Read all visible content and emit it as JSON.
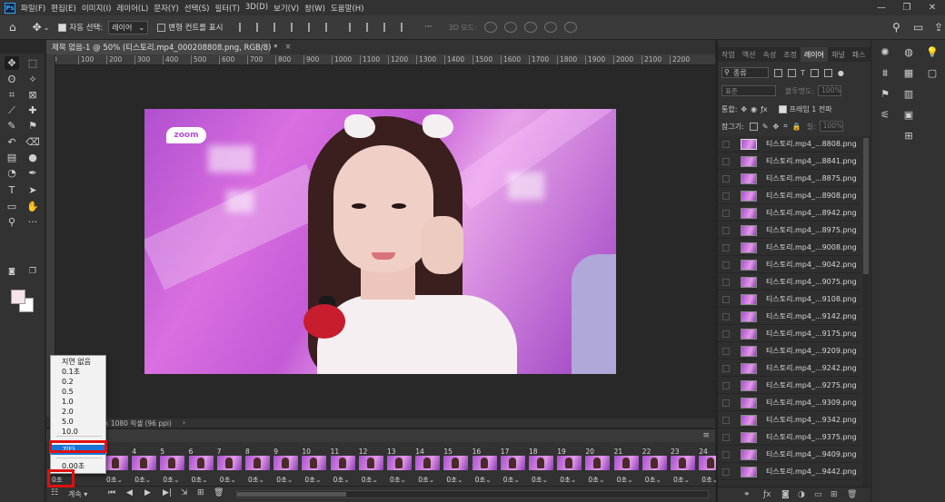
{
  "menu": {
    "logo": "Ps",
    "items": [
      "파일(F)",
      "편집(E)",
      "이미지(I)",
      "레이어(L)",
      "문자(Y)",
      "선택(S)",
      "필터(T)",
      "3D(D)",
      "보기(V)",
      "창(W)",
      "도움말(H)"
    ],
    "window_controls": [
      "—",
      "❐",
      "✕"
    ]
  },
  "options": {
    "auto_select_label": "자동 선택:",
    "auto_select_value": "레이어",
    "transform_label": "변형 컨트롤 표시",
    "mode_3d_label": "3D 모드:"
  },
  "document": {
    "tab_title": "제목 없음-1 @ 50% (티스토리.mp4_000208808.png, RGB/8) *",
    "tab_close": "×",
    "ruler_ticks": [
      "0",
      "100",
      "200",
      "300",
      "400",
      "500",
      "600",
      "700",
      "800",
      "900",
      "1000",
      "1100",
      "1200",
      "1300",
      "1400",
      "1500",
      "1600",
      "1700",
      "1800",
      "1900",
      "2000",
      "2100",
      "2200"
    ],
    "watermark_text": "zoom",
    "status_text": "x 1080 픽셀 (96 ppi)",
    "status_arrow": "›"
  },
  "timeline": {
    "frames": [
      {
        "num": "3",
        "delay": "0초"
      },
      {
        "num": "4",
        "delay": "0초"
      },
      {
        "num": "5",
        "delay": "0초"
      },
      {
        "num": "6",
        "delay": "0초"
      },
      {
        "num": "7",
        "delay": "0초"
      },
      {
        "num": "8",
        "delay": "0초"
      },
      {
        "num": "9",
        "delay": "0초"
      },
      {
        "num": "10",
        "delay": "0초"
      },
      {
        "num": "11",
        "delay": "0초"
      },
      {
        "num": "12",
        "delay": "0초"
      },
      {
        "num": "13",
        "delay": "0초"
      },
      {
        "num": "14",
        "delay": "0초"
      },
      {
        "num": "15",
        "delay": "0초"
      },
      {
        "num": "16",
        "delay": "0초"
      },
      {
        "num": "17",
        "delay": "0초"
      },
      {
        "num": "18",
        "delay": "0초"
      },
      {
        "num": "19",
        "delay": "0초"
      },
      {
        "num": "20",
        "delay": "0초"
      },
      {
        "num": "21",
        "delay": "0초"
      },
      {
        "num": "22",
        "delay": "0초"
      },
      {
        "num": "23",
        "delay": "0초"
      },
      {
        "num": "24",
        "delay": "0초"
      }
    ],
    "first_frame_delay": "0초",
    "loop_label": "계속",
    "panel_menu": "≡"
  },
  "delay_menu": {
    "items": [
      "지연 없음",
      "0.1초",
      "0.2",
      "0.5",
      "1.0",
      "2.0",
      "5.0",
      "10.0"
    ],
    "other": "기타...",
    "current": "0.00초"
  },
  "panel": {
    "tabs": [
      "작업",
      "액션",
      "속성",
      "조정",
      "레이어",
      "채널",
      "패스"
    ],
    "active_tab": "레이어",
    "filter_label": "종류",
    "blend_mode": "표준",
    "opacity_label": "불투명도:",
    "opacity_value": "100%",
    "unify_label": "통합:",
    "propagate_label": "프레임 1 전파",
    "lock_label": "잠그기:",
    "fill_label": "칠:",
    "fill_value": "100%",
    "layers": [
      "티스토리.mp4_...8808.png",
      "티스토리.mp4_...8841.png",
      "티스토리.mp4_...8875.png",
      "티스토리.mp4_...8908.png",
      "티스토리.mp4_...8942.png",
      "티스토리.mp4_...8975.png",
      "티스토리.mp4_...9008.png",
      "티스토리.mp4_...9042.png",
      "티스토리.mp4_...9075.png",
      "티스토리.mp4_...9108.png",
      "티스토리.mp4_...9142.png",
      "티스토리.mp4_...9175.png",
      "티스토리.mp4_...9209.png",
      "티스토리.mp4_...9242.png",
      "티스토리.mp4_...9275.png",
      "티스토리.mp4_...9309.png",
      "티스토리.mp4_...9342.png",
      "티스토리.mp4_...9375.png",
      "티스토리.mp4_...9409.png",
      "티스토리.mp4_...9442.png"
    ]
  },
  "colors": {
    "foreground": "#f6e4ea",
    "background": "#ffffff",
    "highlight": "#e01010",
    "selection": "#1a73d6"
  }
}
